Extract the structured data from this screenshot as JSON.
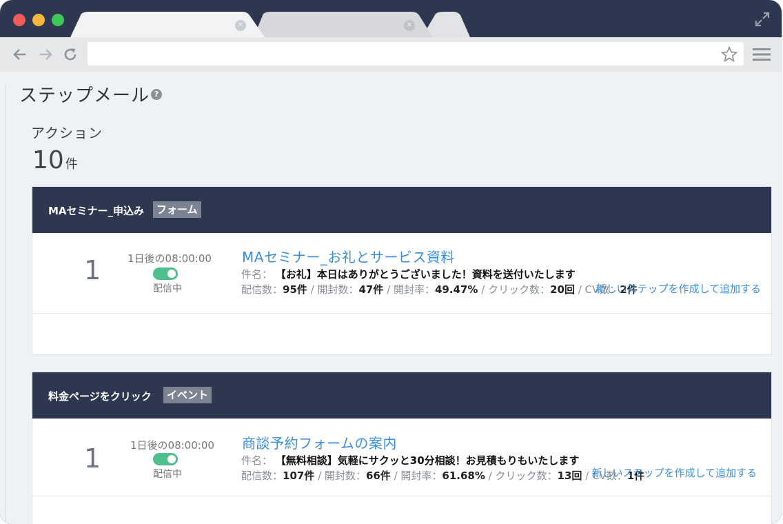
{
  "browser": {
    "icons": {
      "back": "arrow-left-icon",
      "forward": "arrow-right-icon",
      "reload": "reload-icon",
      "star": "star-icon",
      "menu": "hamburger-menu-icon",
      "expand": "expand-icon",
      "tab_close": "close-icon"
    },
    "url": ""
  },
  "page": {
    "title": "ステップメール",
    "help": "?",
    "action_label": "アクション",
    "count": "10",
    "count_unit": "件"
  },
  "scenarios": [
    {
      "title": "MAセミナー_申込み",
      "tag": "フォーム",
      "step": {
        "number": "1",
        "delay": "1日後の08:00:00",
        "toggle_on": true,
        "status": "配信中",
        "mail_title": "MAセミナー_お礼とサービス資料",
        "subject_label": "件名：",
        "subject": "【お礼】本日はありがとうございました！資料を送付いたします",
        "stats": {
          "sent_label": "配信数：",
          "sent": "95件",
          "open_label": "開封数：",
          "open": "47件",
          "rate_label": "開封率：",
          "rate": "49.47%",
          "click_label": "クリック数：",
          "click": "20回",
          "cv_label": "CV数：",
          "cv": "2件"
        }
      },
      "add_link": "新しいステップを作成して追加する"
    },
    {
      "title": "料金ページをクリック",
      "tag": "イベント",
      "step": {
        "number": "1",
        "delay": "1日後の08:00:00",
        "toggle_on": true,
        "status": "配信中",
        "mail_title": "商談予約フォームの案内",
        "subject_label": "件名：",
        "subject": "【無料相談】気軽にサクッと30分相談！お見積もりもいたします",
        "stats": {
          "sent_label": "配信数：",
          "sent": "107件",
          "open_label": "開封数：",
          "open": "66件",
          "rate_label": "開封率：",
          "rate": "61.68%",
          "click_label": "クリック数：",
          "click": "13回",
          "cv_label": "CV数：",
          "cv": "1件"
        }
      },
      "add_link": "新しいステップを作成して追加する"
    }
  ],
  "colors": {
    "header_navy": "#2e3750",
    "link_blue": "#3a8fe0",
    "toggle_green": "#4fc08d",
    "tag_gray": "#7d8393"
  }
}
